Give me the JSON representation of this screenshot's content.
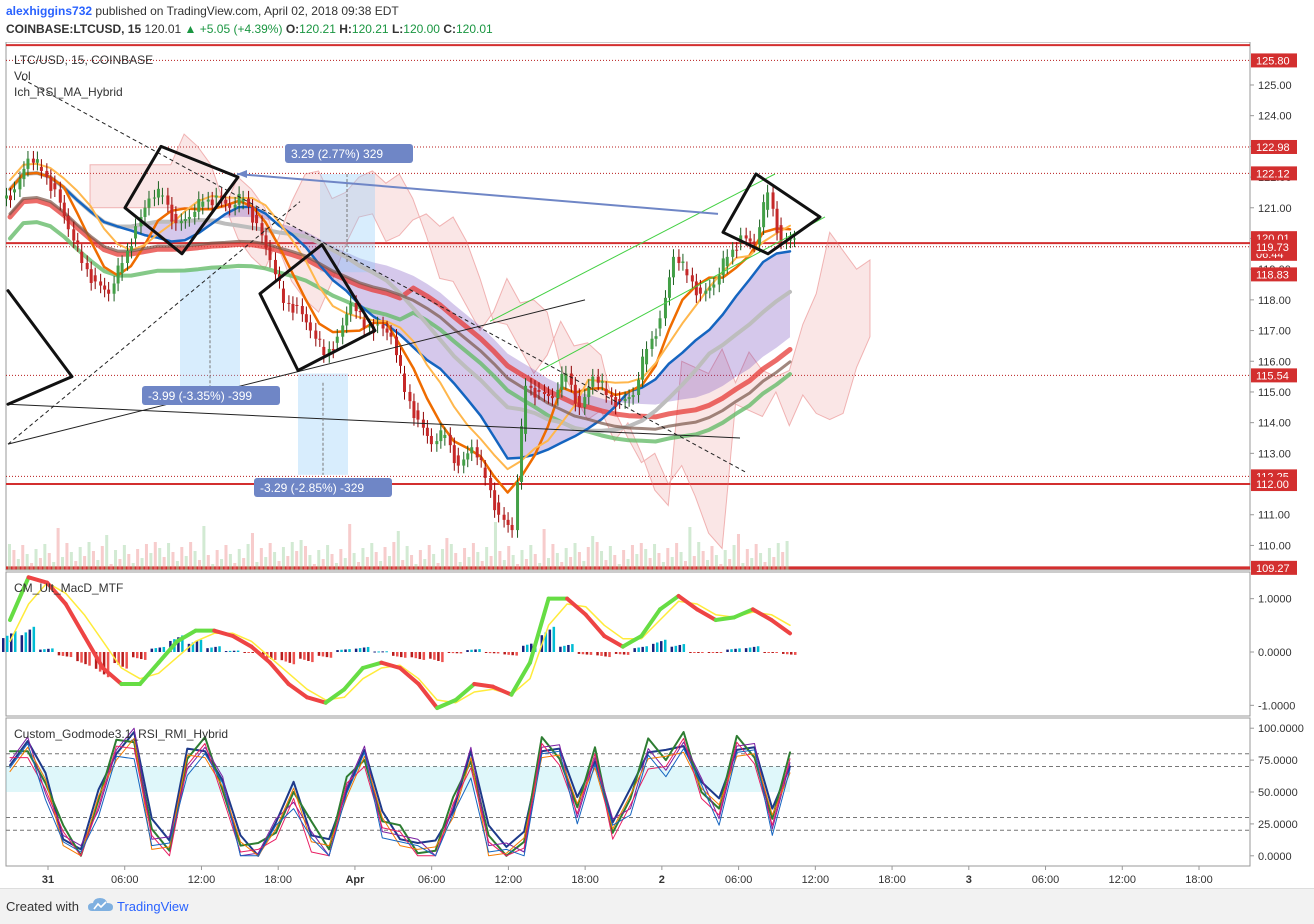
{
  "header": {
    "author": "alexhiggins732",
    "published": "published on TradingView.com, April 02, 2018 09:38 EDT",
    "symbol": "COINBASE:LTCUSD, 15",
    "last": "120.01",
    "change": "+5.05 (+4.39%)",
    "o_label": "O:",
    "o_value": "120.21",
    "h_label": "H:",
    "h_value": "120.21",
    "l_label": "L:",
    "l_value": "120.00",
    "c_label": "C:",
    "c_value": "120.01"
  },
  "chart_data": {
    "type": "candlestick",
    "main": {
      "title": "LTC/USD, 15, COINBASE",
      "legend": [
        "Vol",
        "Ich_RSI_MA_Hybrid"
      ],
      "ylim": [
        109.2,
        126.4
      ],
      "yticks": [
        "125.00",
        "124.00",
        "123.00",
        "122.00",
        "121.00",
        "120.00",
        "119.00",
        "118.00",
        "117.00",
        "116.00",
        "115.00",
        "114.00",
        "113.00",
        "112.00",
        "111.00",
        "110.00"
      ],
      "price_tags": [
        {
          "label": "125.80",
          "value": 125.8
        },
        {
          "label": "122.98",
          "value": 122.98
        },
        {
          "label": "122.12",
          "value": 122.12
        },
        {
          "label": "120.01",
          "value": 120.01
        },
        {
          "label": "06:44",
          "value": 119.5
        },
        {
          "label": "119.73",
          "value": 119.73
        },
        {
          "label": "118.83",
          "value": 118.83
        },
        {
          "label": "115.54",
          "value": 115.54
        },
        {
          "label": "112.25",
          "value": 112.25
        },
        {
          "label": "112.00",
          "value": 112.0
        },
        {
          "label": "109.27",
          "value": 109.27
        }
      ],
      "measure_labels": [
        {
          "text": "3.29 (2.77%) 329"
        },
        {
          "text": "-3.99 (-3.35%) -399"
        },
        {
          "text": "-3.29 (-2.85%) -329"
        }
      ],
      "close_series": [
        121.6,
        122.6,
        122.2,
        121.6,
        120.3,
        119.2,
        118.6,
        118.2,
        119.2,
        120.4,
        121.3,
        121.4,
        120.5,
        120.7,
        121.2,
        121.4,
        121.0,
        121.3,
        120.5,
        119.3,
        117.9,
        117.8,
        117.0,
        116.2,
        116.8,
        117.9,
        117.1,
        117.2,
        116.8,
        115.0,
        114.1,
        113.3,
        113.6,
        112.6,
        113.2,
        112.2,
        111.0,
        110.5,
        115.2,
        115.0,
        114.8,
        115.6,
        114.5,
        115.5,
        114.9,
        114.7,
        114.9,
        116.4,
        117.4,
        119.4,
        118.8,
        118.2,
        118.5,
        119.4,
        120.1,
        119.8,
        121.5,
        119.9,
        120.0
      ]
    },
    "macd": {
      "title": "CM_Ult_MacD_MTF",
      "ylim": [
        -1.2,
        1.5
      ],
      "yticks": [
        "1.0000",
        "0.0000",
        "-1.0000"
      ],
      "macd": [
        0.6,
        1.4,
        1.3,
        0.9,
        0.3,
        -0.3,
        -0.6,
        -0.6,
        -0.2,
        0.2,
        0.4,
        0.4,
        0.3,
        0.1,
        -0.2,
        -0.6,
        -0.85,
        -0.95,
        -0.7,
        -0.3,
        -0.2,
        -0.3,
        -0.6,
        -1.05,
        -0.9,
        -0.6,
        -0.65,
        -0.8,
        -0.2,
        1.0,
        1.0,
        0.7,
        0.3,
        0.1,
        0.3,
        0.8,
        1.05,
        0.8,
        0.6,
        0.65,
        0.8,
        0.6,
        0.35
      ],
      "signal": [
        0.2,
        0.9,
        1.3,
        1.1,
        0.7,
        0.2,
        -0.3,
        -0.5,
        -0.4,
        -0.1,
        0.2,
        0.35,
        0.35,
        0.2,
        -0.1,
        -0.4,
        -0.7,
        -0.9,
        -0.85,
        -0.5,
        -0.3,
        -0.25,
        -0.5,
        -0.9,
        -0.95,
        -0.75,
        -0.7,
        -0.8,
        -0.5,
        0.5,
        0.9,
        0.85,
        0.5,
        0.25,
        0.25,
        0.6,
        0.95,
        0.9,
        0.7,
        0.65,
        0.75,
        0.7,
        0.5
      ]
    },
    "rsi": {
      "title": "Custom_Godmode3.1_RSI_RMI_Hybrid",
      "ylim": [
        -8,
        108
      ],
      "yticks": [
        "100.0000",
        "75.0000",
        "50.0000",
        "25.0000",
        "0.0000"
      ],
      "rsi": [
        80,
        92,
        60,
        20,
        5,
        45,
        85,
        95,
        20,
        15,
        80,
        90,
        60,
        10,
        5,
        25,
        50,
        20,
        10,
        60,
        85,
        30,
        20,
        10,
        5,
        40,
        80,
        15,
        10,
        15,
        90,
        85,
        40,
        80,
        25,
        45,
        85,
        80,
        95,
        60,
        40,
        90,
        85,
        30,
        75
      ]
    },
    "x_ticks": [
      "31",
      "06:00",
      "12:00",
      "18:00",
      "Apr",
      "06:00",
      "12:00",
      "18:00",
      "2",
      "06:00",
      "12:00",
      "18:00",
      "3",
      "06:00",
      "12:00",
      "18:00"
    ]
  },
  "footer": {
    "created_with": "Created with",
    "brand": "TradingView"
  },
  "colors": {
    "up": "#26a69a",
    "down": "#c62828",
    "accent": "#2962ff",
    "tag_red": "#e53935"
  }
}
